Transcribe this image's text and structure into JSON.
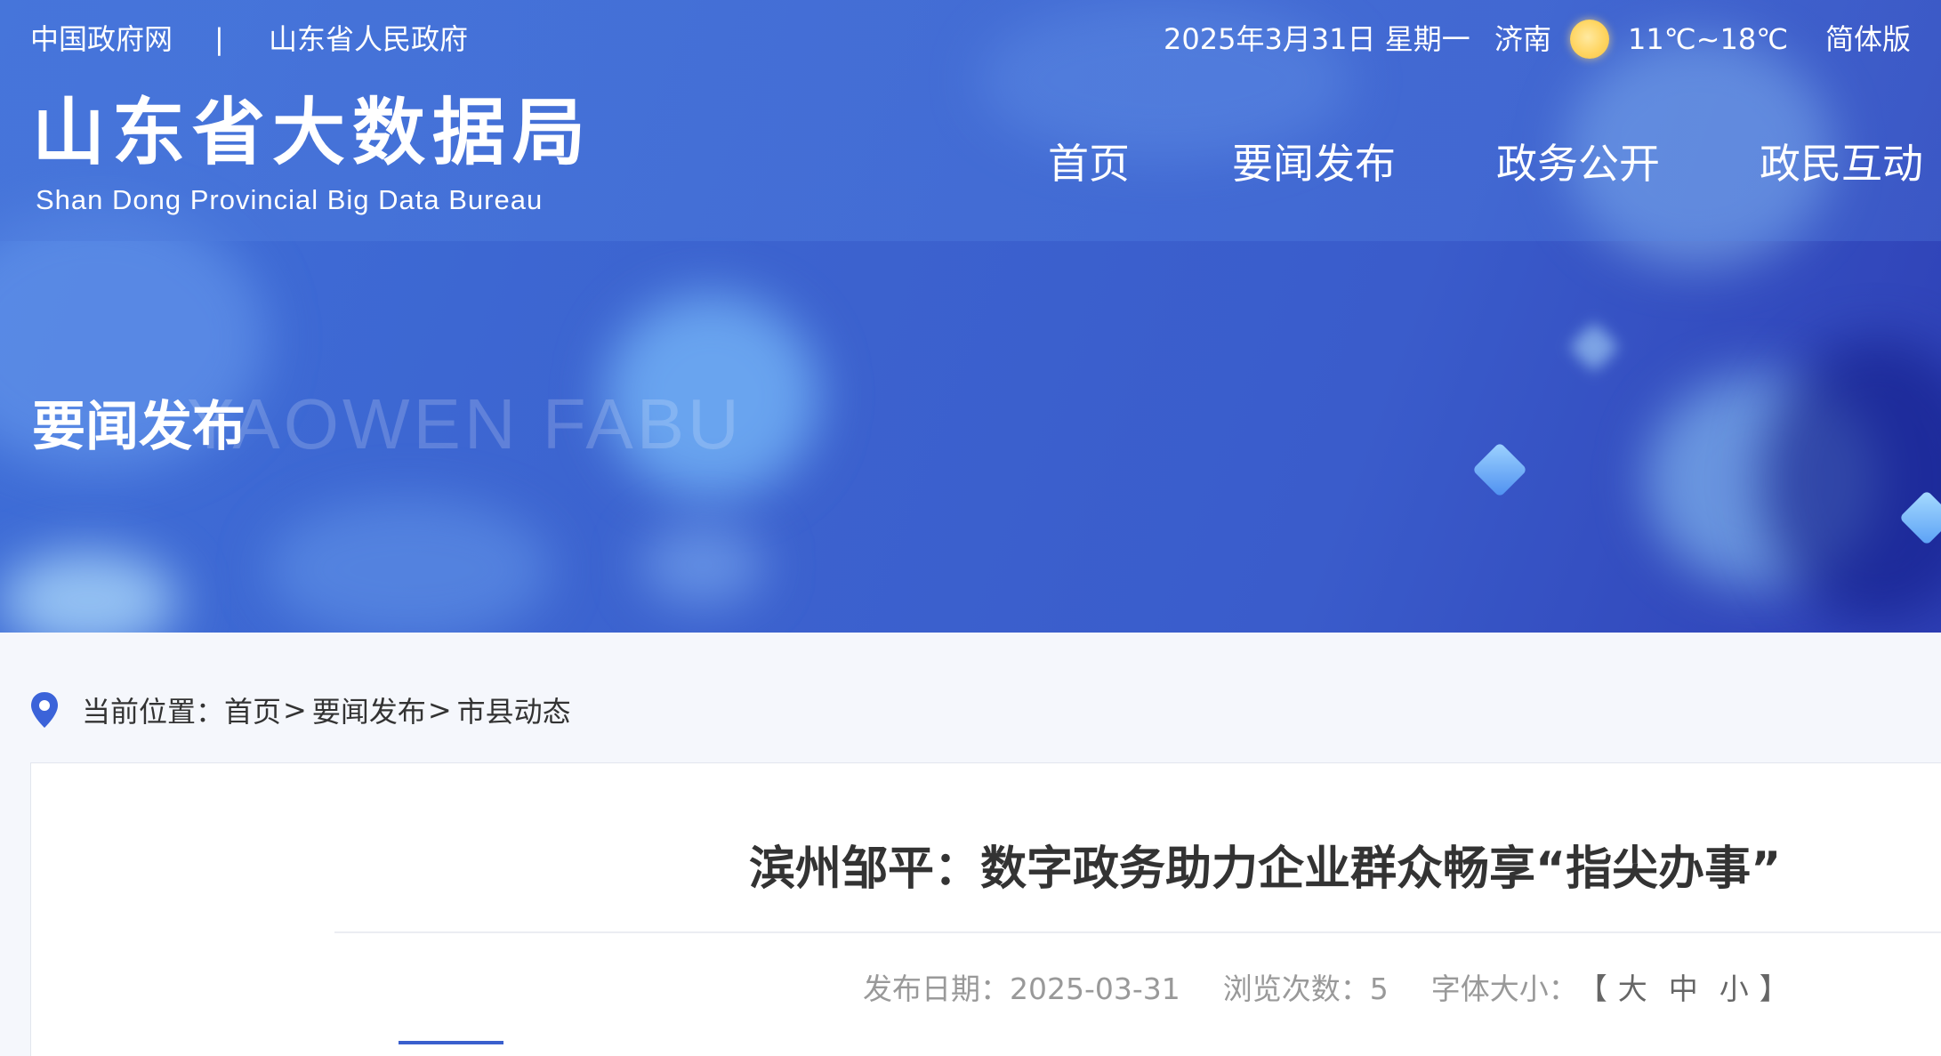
{
  "top_links": {
    "gov_cn": "中国政府网",
    "separator": "|",
    "shandong_gov": "山东省人民政府"
  },
  "top_info": {
    "date": "2025年3月31日 星期一",
    "city": "济南",
    "weather_icon": "sun-icon",
    "temperature": "11℃~18℃",
    "language": "简体版"
  },
  "site": {
    "title": "山东省大数据局",
    "subtitle": "Shan Dong Provincial Big Data Bureau"
  },
  "nav": [
    {
      "label": "首页"
    },
    {
      "label": "要闻发布"
    },
    {
      "label": "政务公开"
    },
    {
      "label": "政民互动"
    }
  ],
  "section": {
    "title": "要闻发布",
    "watermark": "YAOWEN FABU"
  },
  "breadcrumb": {
    "icon": "location-pin-icon",
    "prefix": "当前位置：",
    "items": [
      "首页",
      "要闻发布",
      "市县动态"
    ],
    "separator": ">"
  },
  "article": {
    "title": "滨州邹平：数字政务助力企业群众畅享“指尖办事”",
    "publish_label": "发布日期：",
    "publish_date": "2025-03-31",
    "views_label": "浏览次数：",
    "views": "5",
    "font_size_label": "字体大小：",
    "bracket_open": "【",
    "bracket_close": "】",
    "font_sizes": [
      "大",
      "中",
      "小"
    ]
  },
  "colors": {
    "banner": "#3c63cf",
    "accent": "#3a5fcd",
    "pin": "#3b63d9",
    "page_bg": "#f5f7fc"
  }
}
